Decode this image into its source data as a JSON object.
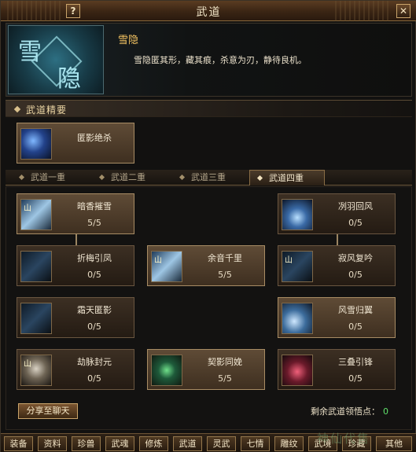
{
  "window": {
    "title": "武道",
    "help_label": "?",
    "close_label": "✕"
  },
  "header": {
    "emblem_text": [
      "雪",
      "隐"
    ],
    "skill_name": "雪隐",
    "skill_desc": "雪隐匿其形，藏其痕，杀意为刃，静待良机。"
  },
  "section": {
    "title": "武道精要"
  },
  "essence_skill": {
    "name": "匿影绝杀",
    "icon": "blue-spirit-icon"
  },
  "tabs": [
    {
      "label": "武道一重",
      "active": false
    },
    {
      "label": "武道二重",
      "active": false
    },
    {
      "label": "武道三重",
      "active": false
    },
    {
      "label": "武道四重",
      "active": true
    }
  ],
  "skills": [
    {
      "name": "暗香摧雪",
      "level": "5/5",
      "icon": "ice-sword-icon",
      "active": true
    },
    {
      "name": "冽羽回风",
      "level": "0/5",
      "icon": "storm-icon",
      "active": false
    },
    {
      "name": "折梅引凤",
      "level": "0/5",
      "icon": "dark-blade-icon",
      "active": false
    },
    {
      "name": "余音千里",
      "level": "5/5",
      "icon": "ice-sword-icon",
      "active": true
    },
    {
      "name": "寂风复吟",
      "level": "0/5",
      "icon": "dark-blade-icon",
      "active": false
    },
    {
      "name": "霜天匿影",
      "level": "0/5",
      "icon": "ice-shards-icon",
      "active": false
    },
    {
      "name": "风雪归翼",
      "level": "0/5",
      "icon": "wing-icon",
      "active": true
    },
    {
      "name": "劫脉封元",
      "level": "0/5",
      "icon": "old-man-icon",
      "active": false
    },
    {
      "name": "契影同娩",
      "level": "5/5",
      "icon": "green-aura-icon",
      "active": true
    },
    {
      "name": "三叠引锋",
      "level": "0/5",
      "icon": "red-blade-icon",
      "active": false
    }
  ],
  "share_button": "分享至聊天",
  "remaining_points": {
    "label": "剩余武道领悟点：",
    "value": "0"
  },
  "bottom_tabs": [
    "装备",
    "资料",
    "珍兽",
    "武魂",
    "修炼",
    "武道",
    "灵武",
    "七情",
    "雕纹",
    "武境",
    "珍藏",
    "其他"
  ],
  "watermark": "神仙代售"
}
